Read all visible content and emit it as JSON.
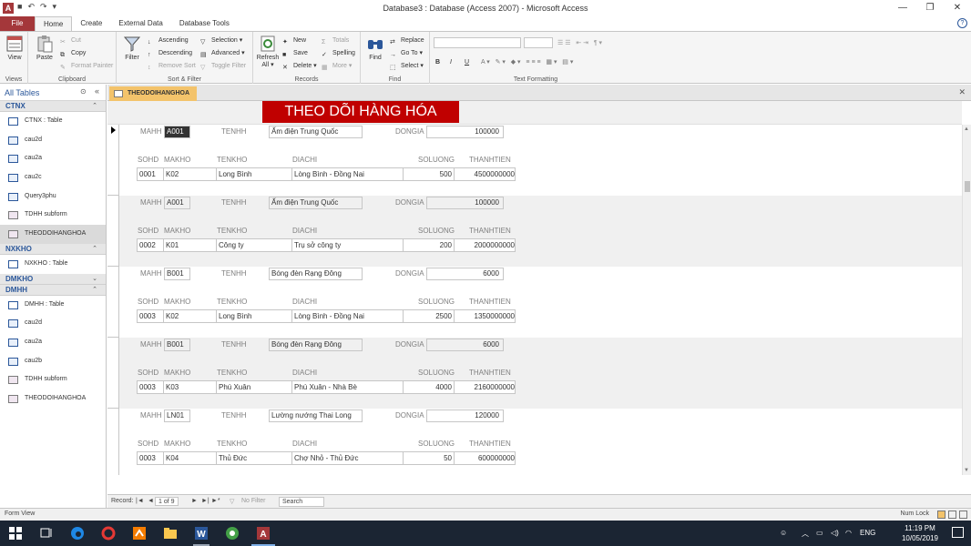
{
  "window": {
    "title": "Database3 : Database (Access 2007) - Microsoft Access",
    "app_icon": "A",
    "minimize": "—",
    "maximize": "❐",
    "close": "✕"
  },
  "ribbon_tabs": [
    "File",
    "Home",
    "Create",
    "External Data",
    "Database Tools"
  ],
  "ribbon": {
    "views": {
      "view": "View",
      "group": "Views"
    },
    "clipboard": {
      "paste": "Paste",
      "cut": "Cut",
      "copy": "Copy",
      "format_painter": "Format Painter",
      "group": "Clipboard"
    },
    "sort_filter": {
      "filter": "Filter",
      "ascending": "Ascending",
      "descending": "Descending",
      "remove_sort": "Remove Sort",
      "selection": "Selection",
      "advanced": "Advanced",
      "toggle_filter": "Toggle Filter",
      "group": "Sort & Filter"
    },
    "records": {
      "refresh": "Refresh",
      "all": "All",
      "new": "New",
      "save": "Save",
      "delete": "Delete",
      "totals": "Totals",
      "spelling": "Spelling",
      "more": "More",
      "group": "Records"
    },
    "find": {
      "find": "Find",
      "replace": "Replace",
      "goto": "Go To",
      "select": "Select",
      "group": "Find"
    },
    "text_formatting": {
      "bold": "B",
      "italic": "I",
      "underline": "U",
      "group": "Text Formatting"
    }
  },
  "nav": {
    "title": "All Tables",
    "groups": [
      {
        "name": "CTNX",
        "items": [
          {
            "label": "CTNX : Table",
            "type": "table"
          },
          {
            "label": "cau2d",
            "type": "query"
          },
          {
            "label": "cau2a",
            "type": "query"
          },
          {
            "label": "cau2c",
            "type": "query"
          },
          {
            "label": "Query3phu",
            "type": "query"
          },
          {
            "label": "TDHH subform",
            "type": "form"
          },
          {
            "label": "THEODOIHANGHOA",
            "type": "form"
          }
        ]
      },
      {
        "name": "NXKHO",
        "items": [
          {
            "label": "NXKHO : Table",
            "type": "table"
          }
        ]
      },
      {
        "name": "DMKHO",
        "items": []
      },
      {
        "name": "DMHH",
        "items": [
          {
            "label": "DMHH : Table",
            "type": "table"
          },
          {
            "label": "cau2d",
            "type": "query"
          },
          {
            "label": "cau2a",
            "type": "query"
          },
          {
            "label": "cau2b",
            "type": "query"
          },
          {
            "label": "TDHH subform",
            "type": "form"
          },
          {
            "label": "THEODOIHANGHOA",
            "type": "form"
          }
        ]
      }
    ]
  },
  "document_tab": "THEODOIHANGHOA",
  "form": {
    "banner": "THEO DÕI HÀNG HÓA",
    "labels": {
      "mahh": "MAHH",
      "tenhh": "TENHH",
      "dongia": "DONGIA"
    },
    "sub_headers": [
      "SOHD",
      "MAKHO",
      "TENKHO",
      "DIACHI",
      "SOLUONG",
      "THANHTIEN"
    ],
    "records": [
      {
        "mahh": "A001",
        "tenhh": "Ấm điện Trung Quốc",
        "dongia": "100000",
        "row": {
          "sohd": "0001",
          "makho": "K02",
          "tenkho": "Long Bình",
          "diachi": "Lòng Bình - Đồng Nai",
          "soluong": "500",
          "thanhtien": "4500000000"
        }
      },
      {
        "mahh": "A001",
        "tenhh": "Ấm điện Trung Quốc",
        "dongia": "100000",
        "row": {
          "sohd": "0002",
          "makho": "K01",
          "tenkho": "Công ty",
          "diachi": "Trụ sở công ty",
          "soluong": "200",
          "thanhtien": "2000000000"
        }
      },
      {
        "mahh": "B001",
        "tenhh": "Bóng đèn Rạng Đông",
        "dongia": "6000",
        "row": {
          "sohd": "0003",
          "makho": "K02",
          "tenkho": "Long Bình",
          "diachi": "Lòng Bình - Đồng Nai",
          "soluong": "2500",
          "thanhtien": "1350000000"
        }
      },
      {
        "mahh": "B001",
        "tenhh": "Bóng đèn Rạng Đông",
        "dongia": "6000",
        "row": {
          "sohd": "0003",
          "makho": "K03",
          "tenkho": "Phú Xuân",
          "diachi": "Phú Xuân - Nhà Bè",
          "soluong": "4000",
          "thanhtien": "2160000000"
        }
      },
      {
        "mahh": "LN01",
        "tenhh": "Lường nướng Thai Long",
        "dongia": "120000",
        "row": {
          "sohd": "0003",
          "makho": "K04",
          "tenkho": "Thủ Đức",
          "diachi": "Chợ Nhỏ - Thủ Đức",
          "soluong": "50",
          "thanhtien": "600000000"
        }
      }
    ]
  },
  "record_nav": {
    "label": "Record:",
    "position": "1 of 9",
    "filter": "No Filter",
    "search": "Search"
  },
  "status": {
    "left": "Form View",
    "num_lock": "Num Lock"
  },
  "taskbar": {
    "time": "11:19 PM",
    "date": "10/05/2019",
    "lang": "ENG"
  },
  "colors": {
    "file_tab": "#a4373a",
    "banner": "#c00000",
    "doc_tab": "#f3c36b",
    "accent": "#2b579a"
  }
}
